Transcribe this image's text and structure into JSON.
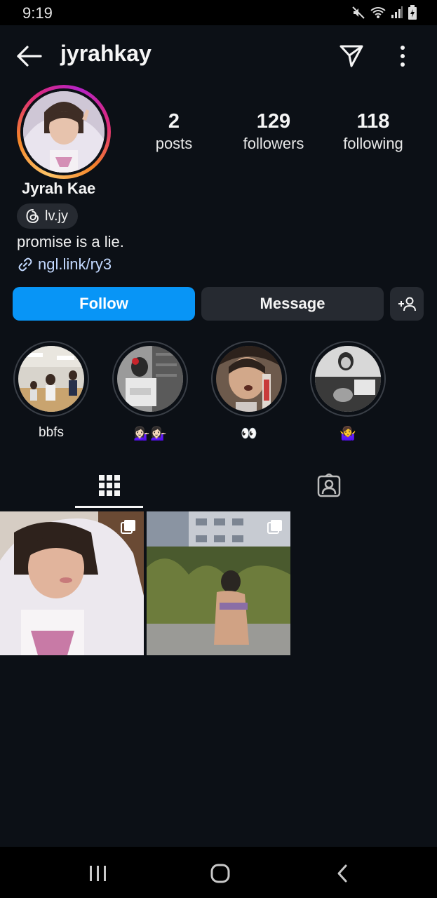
{
  "status_bar": {
    "time": "9:19",
    "icons": [
      "mute-icon",
      "wifi-icon",
      "signal-icon",
      "battery-icon"
    ]
  },
  "header": {
    "username": "jyrahkay",
    "icons": [
      "back-arrow-icon",
      "send-icon",
      "more-icon"
    ]
  },
  "profile": {
    "display_name": "Jyrah Kae",
    "threads_handle": "lv.jy",
    "bio": "promise is a lie.",
    "link": "ngl.link/ry3",
    "stats": {
      "posts": {
        "count": "2",
        "label": "posts"
      },
      "followers": {
        "count": "129",
        "label": "followers"
      },
      "following": {
        "count": "118",
        "label": "following"
      }
    }
  },
  "actions": {
    "follow_label": "Follow",
    "message_label": "Message"
  },
  "highlights": [
    {
      "label": "bbfs"
    },
    {
      "label": "💁🏻‍♀️💁🏻‍♀️"
    },
    {
      "label": "👀"
    },
    {
      "label": "🤷‍♀️"
    }
  ],
  "tabs": [
    "grid-icon",
    "tagged-icon"
  ],
  "colors": {
    "background": "#0c1016",
    "follow_button": "#0895f6",
    "secondary_button": "#262a31",
    "link": "#c3d9ff"
  }
}
